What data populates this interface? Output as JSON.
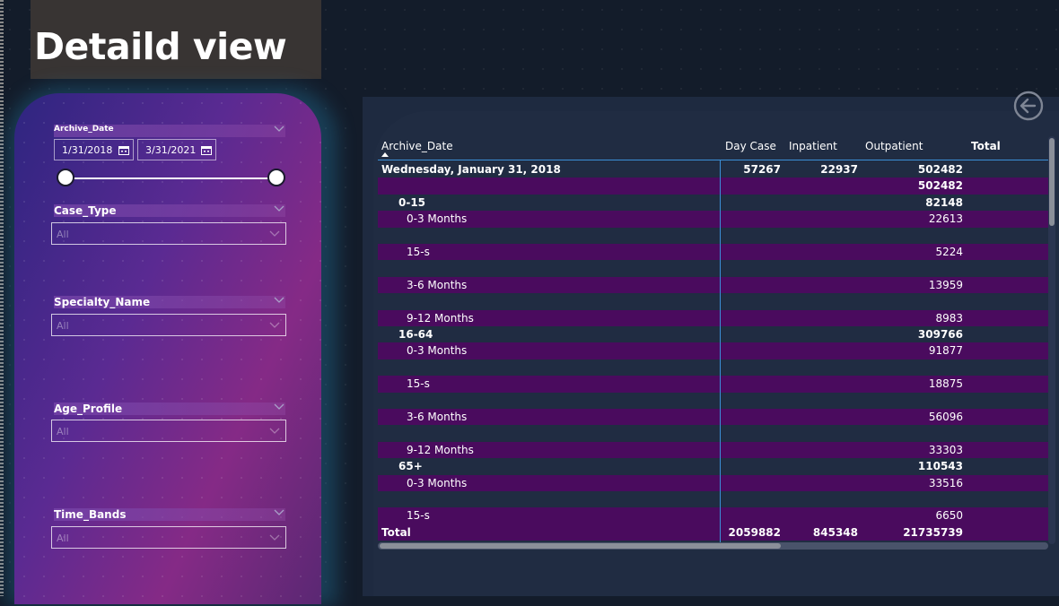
{
  "page": {
    "title": "Detaild view"
  },
  "filters": {
    "archive_date": {
      "label": "Archive_Date",
      "start": "1/31/2018",
      "end": "3/31/2021"
    },
    "case_type": {
      "label": "Case_Type",
      "value": "All"
    },
    "specialty_name": {
      "label": "Specialty_Name",
      "value": "All"
    },
    "age_profile": {
      "label": "Age_Profile",
      "value": "All"
    },
    "time_bands": {
      "label": "Time_Bands",
      "value": "All"
    }
  },
  "table": {
    "columns": [
      "Archive_Date",
      "Day Case",
      "Inpatient",
      "Outpatient",
      "Total"
    ],
    "rows": [
      {
        "label": "Wednesday, January 31, 2018",
        "level": 0,
        "bold": true,
        "purple": false,
        "day_case": "57267",
        "inpatient": "22937",
        "outpatient": "502482"
      },
      {
        "label": "",
        "level": 1,
        "bold": true,
        "purple": true,
        "day_case": "",
        "inpatient": "",
        "outpatient": "502482"
      },
      {
        "label": "0-15",
        "level": 2,
        "bold": true,
        "purple": false,
        "day_case": "",
        "inpatient": "",
        "outpatient": "82148"
      },
      {
        "label": "0-3 Months",
        "level": 3,
        "bold": false,
        "purple": true,
        "day_case": "",
        "inpatient": "",
        "outpatient": "22613"
      },
      {
        "label": "",
        "level": 3,
        "bold": false,
        "purple": false,
        "day_case": "",
        "inpatient": "",
        "outpatient": ""
      },
      {
        "label": "15-s",
        "level": 3,
        "bold": false,
        "purple": true,
        "day_case": "",
        "inpatient": "",
        "outpatient": "5224"
      },
      {
        "label": "",
        "level": 3,
        "bold": false,
        "purple": false,
        "day_case": "",
        "inpatient": "",
        "outpatient": ""
      },
      {
        "label": "3-6 Months",
        "level": 3,
        "bold": false,
        "purple": true,
        "day_case": "",
        "inpatient": "",
        "outpatient": "13959"
      },
      {
        "label": "",
        "level": 3,
        "bold": false,
        "purple": false,
        "day_case": "",
        "inpatient": "",
        "outpatient": ""
      },
      {
        "label": "9-12 Months",
        "level": 3,
        "bold": false,
        "purple": true,
        "day_case": "",
        "inpatient": "",
        "outpatient": "8983"
      },
      {
        "label": "16-64",
        "level": 2,
        "bold": true,
        "purple": false,
        "day_case": "",
        "inpatient": "",
        "outpatient": "309766"
      },
      {
        "label": "0-3 Months",
        "level": 3,
        "bold": false,
        "purple": true,
        "day_case": "",
        "inpatient": "",
        "outpatient": "91877"
      },
      {
        "label": "",
        "level": 3,
        "bold": false,
        "purple": false,
        "day_case": "",
        "inpatient": "",
        "outpatient": ""
      },
      {
        "label": "15-s",
        "level": 3,
        "bold": false,
        "purple": true,
        "day_case": "",
        "inpatient": "",
        "outpatient": "18875"
      },
      {
        "label": "",
        "level": 3,
        "bold": false,
        "purple": false,
        "day_case": "",
        "inpatient": "",
        "outpatient": ""
      },
      {
        "label": "3-6 Months",
        "level": 3,
        "bold": false,
        "purple": true,
        "day_case": "",
        "inpatient": "",
        "outpatient": "56096"
      },
      {
        "label": "",
        "level": 3,
        "bold": false,
        "purple": false,
        "day_case": "",
        "inpatient": "",
        "outpatient": ""
      },
      {
        "label": "9-12 Months",
        "level": 3,
        "bold": false,
        "purple": true,
        "day_case": "",
        "inpatient": "",
        "outpatient": "33303"
      },
      {
        "label": "65+",
        "level": 2,
        "bold": true,
        "purple": false,
        "day_case": "",
        "inpatient": "",
        "outpatient": "110543"
      },
      {
        "label": "0-3 Months",
        "level": 3,
        "bold": false,
        "purple": true,
        "day_case": "",
        "inpatient": "",
        "outpatient": "33516"
      },
      {
        "label": "",
        "level": 3,
        "bold": false,
        "purple": false,
        "day_case": "",
        "inpatient": "",
        "outpatient": ""
      },
      {
        "label": "15-s",
        "level": 3,
        "bold": false,
        "purple": true,
        "day_case": "",
        "inpatient": "",
        "outpatient": "6650"
      }
    ],
    "total": {
      "label": "Total",
      "day_case": "2059882",
      "inpatient": "845348",
      "outpatient": "21735739"
    }
  },
  "colors": {
    "row_highlight": "#4a0b5e",
    "header_line": "#3b8fd8",
    "title_box": "#383433"
  },
  "icons": {
    "back": "arrow-left-circle-icon",
    "calendar": "calendar-icon",
    "chevron": "chevron-down-icon"
  }
}
